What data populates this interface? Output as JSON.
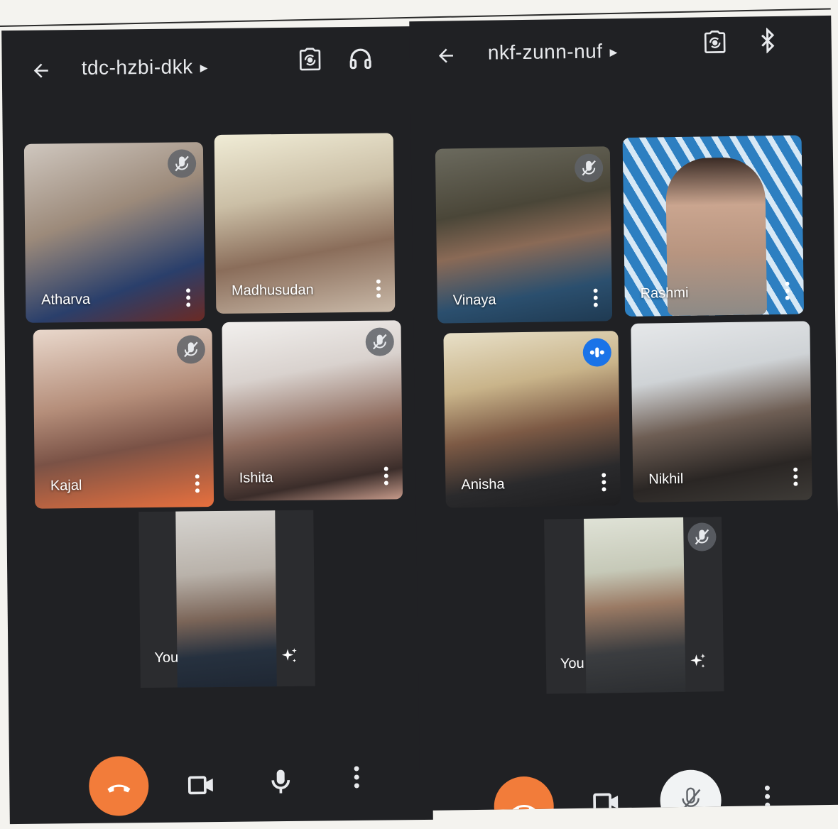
{
  "left": {
    "meeting_code": "tdc-hzbi-dkk",
    "icons": [
      "back-arrow-icon",
      "switch-camera-icon",
      "headphones-icon"
    ],
    "participants": [
      {
        "name": "Atharva",
        "muted": true
      },
      {
        "name": "Madhusudan",
        "muted": false
      },
      {
        "name": "Kajal",
        "muted": true
      },
      {
        "name": "Ishita",
        "muted": true
      }
    ],
    "self_label": "You",
    "controls": [
      "end-call",
      "camera",
      "microphone",
      "more"
    ]
  },
  "right": {
    "meeting_code": "nkf-zunn-nuf",
    "icons": [
      "back-arrow-icon",
      "switch-camera-icon",
      "bluetooth-icon"
    ],
    "participants": [
      {
        "name": "Vinaya",
        "muted": true
      },
      {
        "name": "Rashmi",
        "muted": false
      },
      {
        "name": "Anisha",
        "speaking": true
      },
      {
        "name": "Nikhil",
        "muted": false
      }
    ],
    "self_label": "You",
    "self_muted": true,
    "controls": [
      "end-call",
      "camera",
      "microphone-off",
      "more"
    ]
  },
  "colors": {
    "background": "#202124",
    "end_call": "#f27c3a",
    "speaking": "#1a73e8",
    "text": "#e8eaed"
  }
}
